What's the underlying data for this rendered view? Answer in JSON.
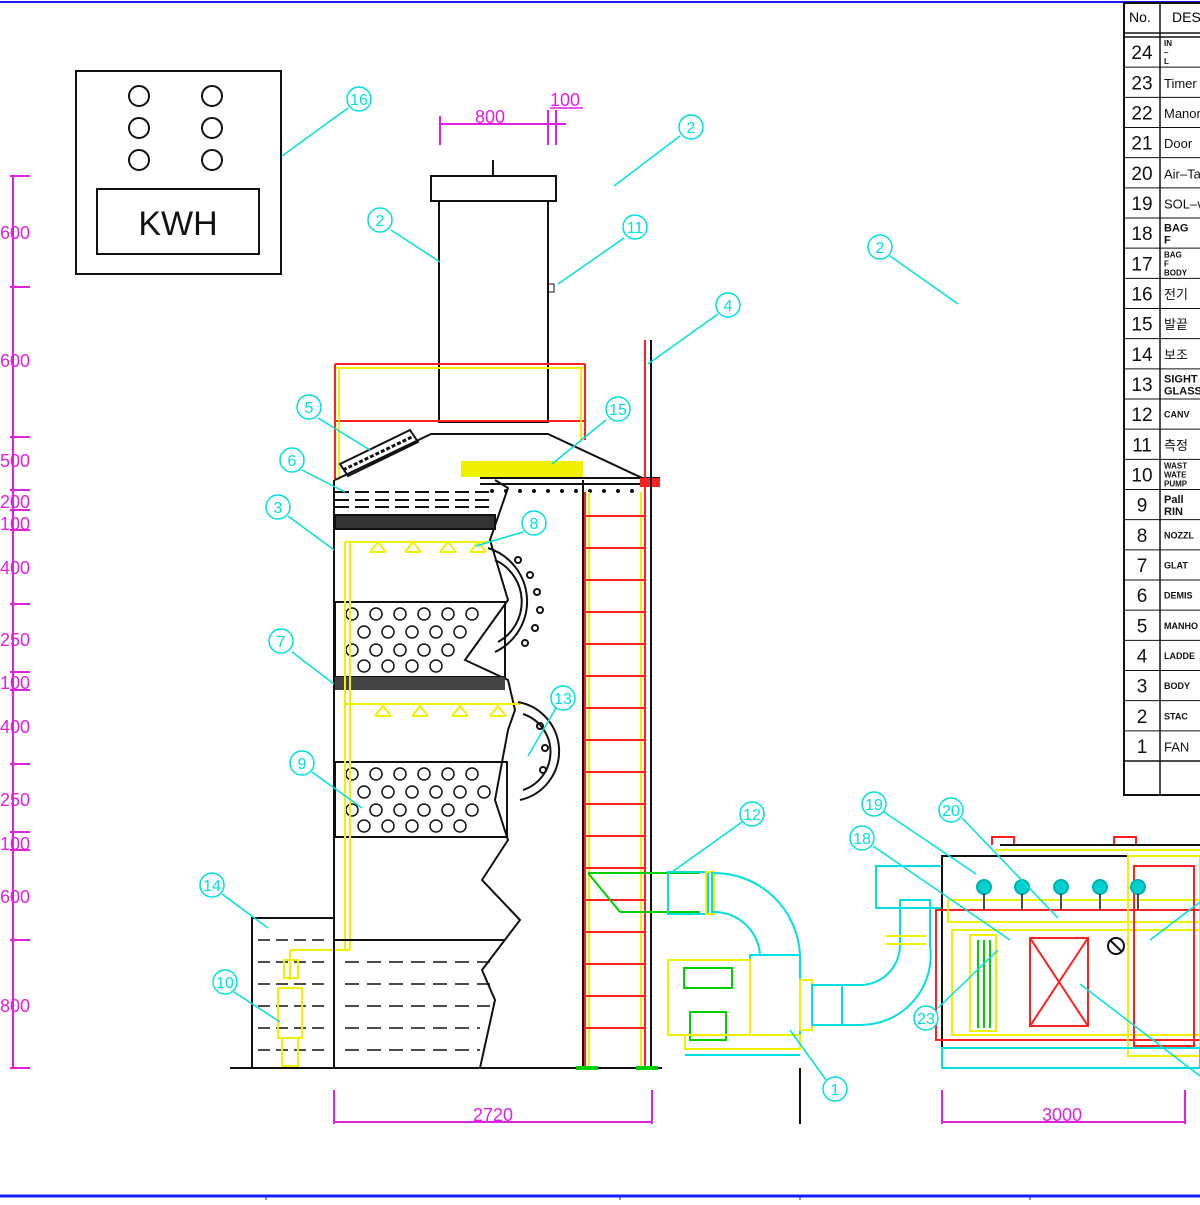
{
  "panel": {
    "label": "KWH"
  },
  "dimensions": {
    "top_width": "800",
    "top_gap": "100",
    "base_width": "2720",
    "filter_width": "3000",
    "left_scale": [
      "600",
      "600",
      "500",
      "200",
      "100",
      "400",
      "250",
      "100",
      "400",
      "250",
      "100",
      "600",
      "800"
    ]
  },
  "balloons": [
    "16",
    "2",
    "2",
    "11",
    "2",
    "2",
    "4",
    "5",
    "15",
    "6",
    "3",
    "8",
    "7",
    "13",
    "9",
    "14",
    "10",
    "12",
    "19",
    "20",
    "18",
    "23",
    "1"
  ],
  "title_block": {
    "header_no": "No.",
    "header_desc": "DES",
    "rows": [
      {
        "no": "24",
        "desc": "IN – L"
      },
      {
        "no": "23",
        "desc": "Timer"
      },
      {
        "no": "22",
        "desc": "Manor"
      },
      {
        "no": "21",
        "desc": "Door"
      },
      {
        "no": "20",
        "desc": "Air–Ta"
      },
      {
        "no": "19",
        "desc": "SOL–v"
      },
      {
        "no": "18",
        "desc": "BAG F"
      },
      {
        "no": "17",
        "desc": "BAG F BODY"
      },
      {
        "no": "16",
        "desc": "전기"
      },
      {
        "no": "15",
        "desc": "발끝"
      },
      {
        "no": "14",
        "desc": "보조"
      },
      {
        "no": "13",
        "desc": "SIGHT GLASS"
      },
      {
        "no": "12",
        "desc": "CANV"
      },
      {
        "no": "11",
        "desc": "측정"
      },
      {
        "no": "10",
        "desc": "WAST WATE PUMP"
      },
      {
        "no": "9",
        "desc": "Pall RIN"
      },
      {
        "no": "8",
        "desc": "NOZZL"
      },
      {
        "no": "7",
        "desc": "GLAT"
      },
      {
        "no": "6",
        "desc": "DEMIS"
      },
      {
        "no": "5",
        "desc": "MANHO"
      },
      {
        "no": "4",
        "desc": "LADDE"
      },
      {
        "no": "3",
        "desc": "BODY"
      },
      {
        "no": "2",
        "desc": "STAC"
      },
      {
        "no": "1",
        "desc": "FAN"
      }
    ]
  },
  "colors": {
    "frame": "#1a1aff",
    "cyan": "#00e0e0",
    "magenta": "#e020e0",
    "yellow": "#f0f000",
    "red": "#ff2020",
    "green": "#00d000",
    "dark": "#222222"
  }
}
